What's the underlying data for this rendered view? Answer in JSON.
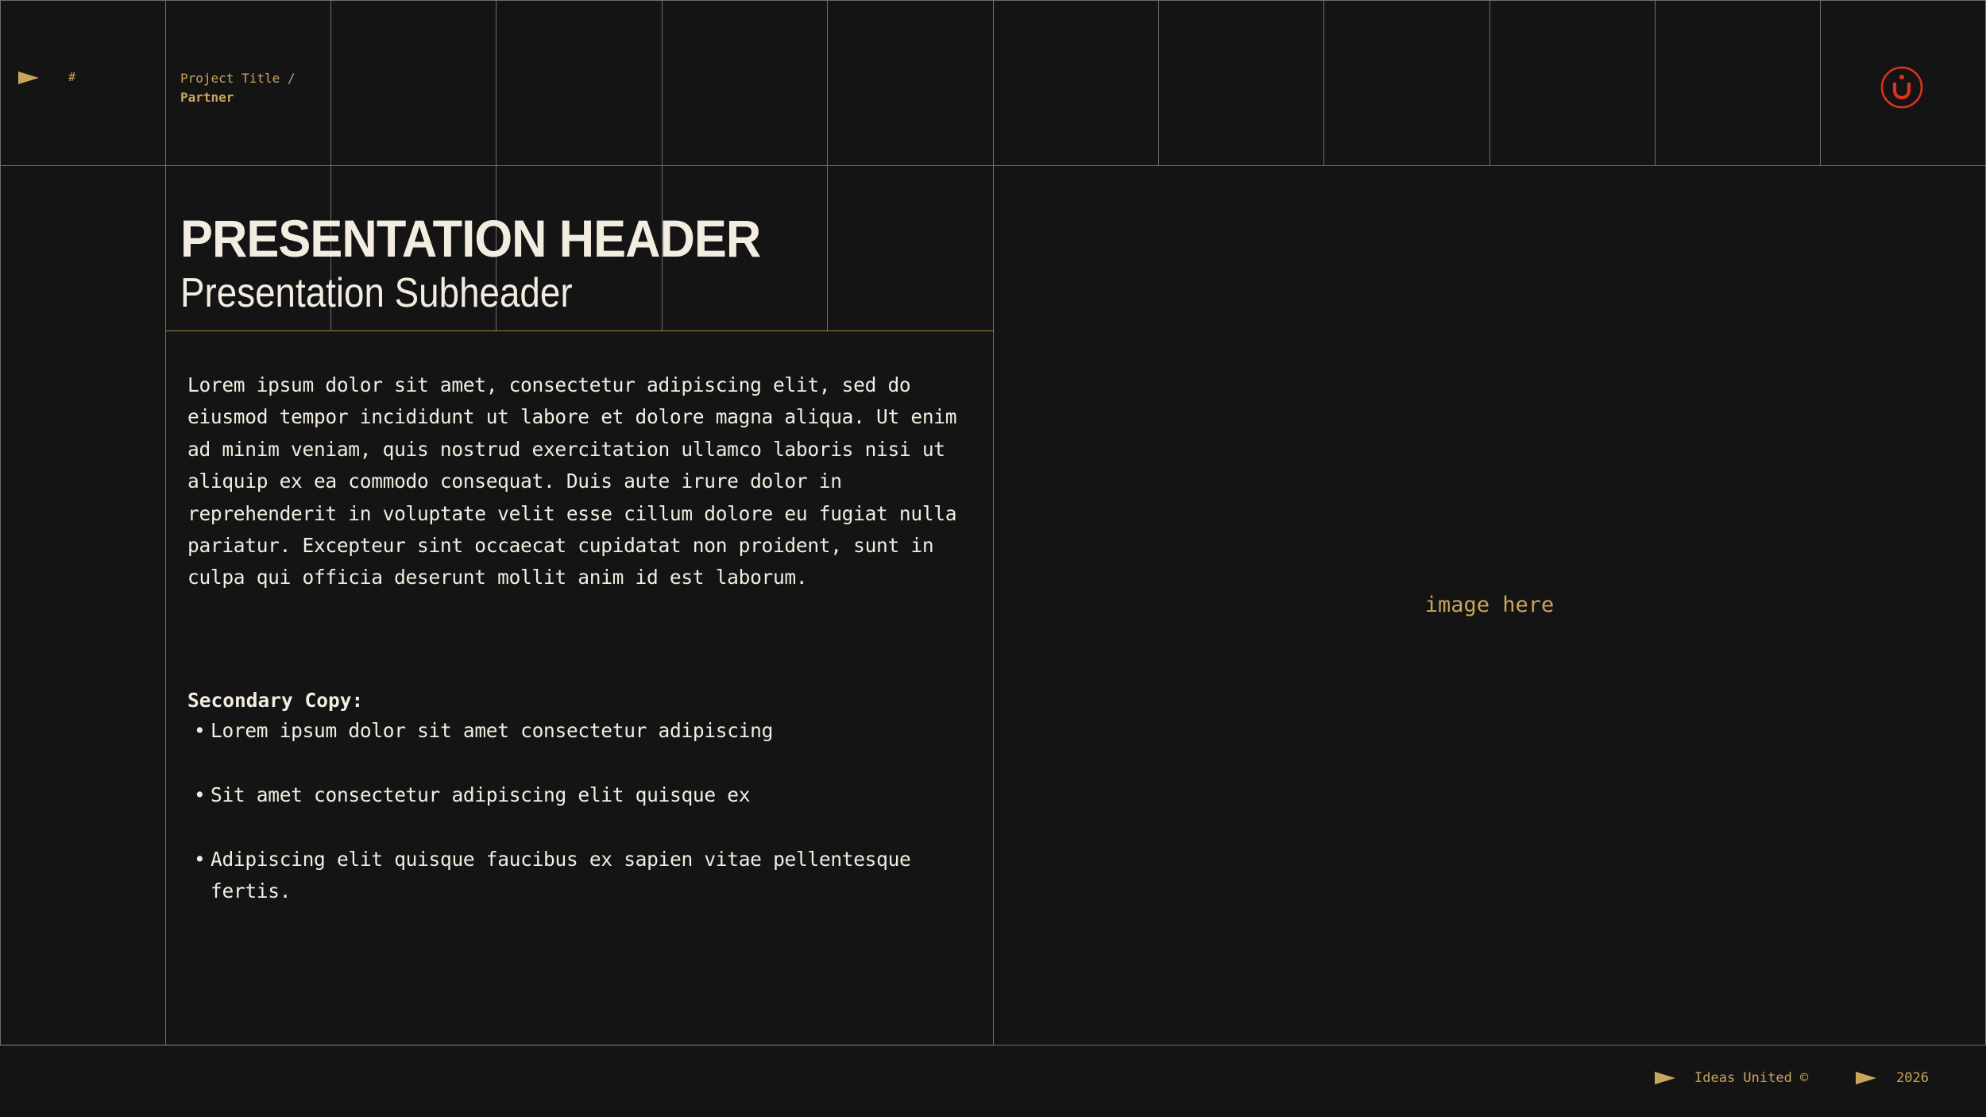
{
  "header": {
    "hash_label": "#",
    "project_title": "Project Title /",
    "partner": "Partner"
  },
  "logo": {
    "icon": "ideas-united-logo-icon",
    "color": "#e0301e"
  },
  "main": {
    "title": "PRESENTATION HEADER",
    "subtitle": "Presentation Subheader",
    "body": "Lorem ipsum dolor sit amet, consectetur adipiscing elit, sed do eiusmod tempor incididunt ut labore et dolore magna aliqua. Ut enim ad minim veniam, quis nostrud exercitation ullamco laboris nisi ut aliquip ex ea commodo consequat. Duis aute irure dolor in reprehenderit in voluptate velit esse cillum dolore eu fugiat nulla pariatur. Excepteur sint occaecat cupidatat non proident, sunt in culpa qui officia deserunt mollit anim id est laborum.",
    "secondary_label": "Secondary Copy:",
    "bullets": [
      "Lorem ipsum dolor sit amet consectetur adipiscing",
      "Sit amet consectetur adipiscing elit quisque ex",
      "Adipiscing elit quisque faucibus ex sapien vitae pellentesque fertis."
    ]
  },
  "image_placeholder": "image here",
  "footer": {
    "company": "Ideas United ©",
    "year": "2026"
  },
  "colors": {
    "background": "#141414",
    "accent_gold": "#c9a45c",
    "text_cream": "#f3ece0",
    "grid_line": "#6e6e6e",
    "brand_red": "#e0301e"
  }
}
